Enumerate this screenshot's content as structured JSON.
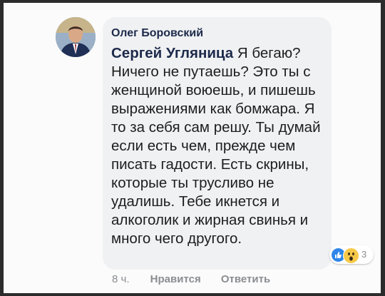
{
  "comment": {
    "author": "Олег Боровский",
    "mention": "Сергей Угляница",
    "text": " Я бегаю? Ничего не путаешь? Это ты с женщиной воюешь, и пишешь выражениями как бомжара. Я то за себя сам решу. Ты думай если есть чем, прежде чем писать гадости. Есть скрины, которые ты трусливо не удалишь. Тебе икнется и алкоголик и жирная свинья и много чего другого."
  },
  "reactions": {
    "count": "3",
    "icons": [
      "like-icon",
      "wow-icon"
    ],
    "colors": {
      "like": "#2f86e8",
      "wow": "#f7c948"
    }
  },
  "meta": {
    "time": "8 ч.",
    "like_label": "Нравится",
    "reply_label": "Ответить"
  }
}
